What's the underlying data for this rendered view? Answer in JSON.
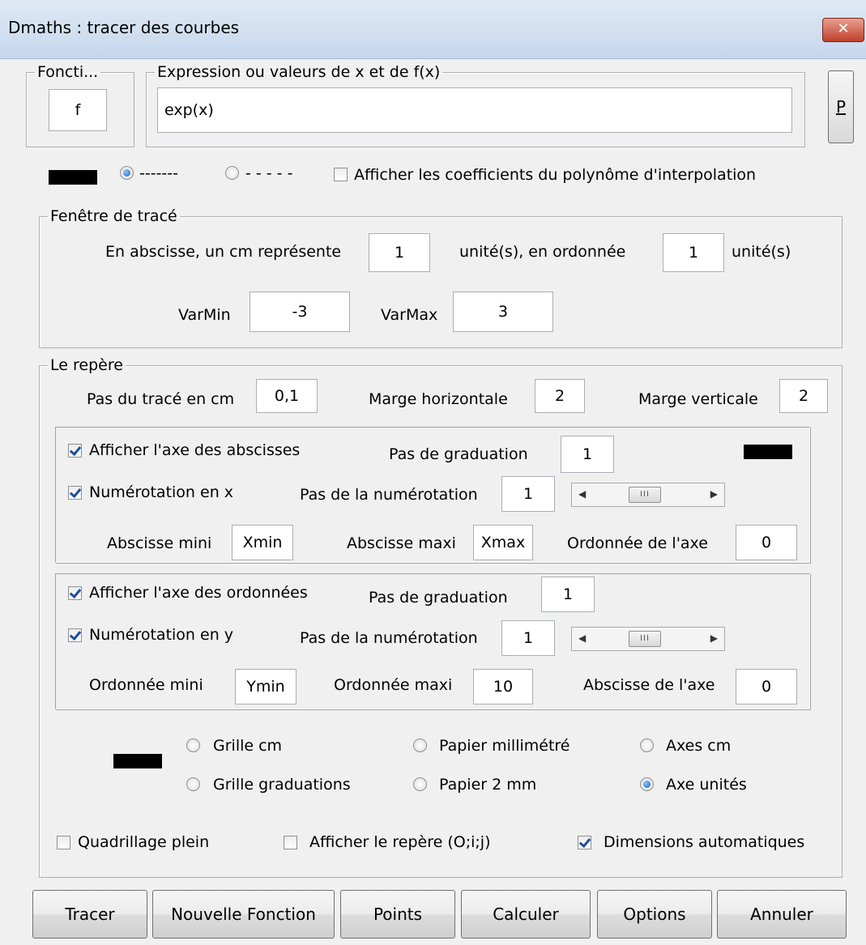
{
  "window": {
    "title": "Dmaths : tracer des courbes",
    "close_glyph": "✕"
  },
  "fonction": {
    "legend": "Foncti...",
    "value": "f"
  },
  "expression": {
    "legend": "Expression ou valeurs de x et de f(x)",
    "value": "exp(x)"
  },
  "p_button": "P",
  "line_style": {
    "color": "#000000",
    "solid_label": "-------",
    "dashed_label": "- - - - -",
    "solid_selected": true,
    "show_coeffs_label": "Afficher les coefficients du polynôme d'interpolation",
    "show_coeffs_checked": false
  },
  "fenetre": {
    "legend": "Fenêtre de tracé",
    "abscisse_label": "En abscisse, un cm représente",
    "abscisse_value": "1",
    "ordonnee_label": "unité(s), en ordonnée",
    "ordonnee_value": "1",
    "unit_label": "unité(s)",
    "varmin_label": "VarMin",
    "varmin_value": "-3",
    "varmax_label": "VarMax",
    "varmax_value": "3"
  },
  "repere": {
    "legend": "Le repère",
    "pas_trace_label": "Pas du tracé en cm",
    "pas_trace_value": "0,1",
    "marge_h_label": "Marge horizontale",
    "marge_h_value": "2",
    "marge_v_label": "Marge verticale",
    "marge_v_value": "2"
  },
  "axe_x": {
    "show_label": "Afficher l'axe des abscisses",
    "show_checked": true,
    "grad_label": "Pas de graduation",
    "grad_value": "1",
    "num_label": "Numérotation en x",
    "num_checked": true,
    "num_pas_label": "Pas de la numérotation",
    "num_pas_value": "1",
    "min_label": "Abscisse mini",
    "min_value": "Xmin",
    "max_label": "Abscisse maxi",
    "max_value": "Xmax",
    "axis_label": "Ordonnée de l'axe",
    "axis_value": "0",
    "color": "#000000"
  },
  "axe_y": {
    "show_label": "Afficher l'axe des ordonnées",
    "show_checked": true,
    "grad_label": "Pas de graduation",
    "grad_value": "1",
    "num_label": "Numérotation en y",
    "num_checked": true,
    "num_pas_label": "Pas de la numérotation",
    "num_pas_value": "1",
    "min_label": "Ordonnée mini",
    "min_value": "Ymin",
    "max_label": "Ordonnée maxi",
    "max_value": "10",
    "axis_label": "Abscisse de l'axe",
    "axis_value": "0"
  },
  "grille": {
    "color": "#000000",
    "grille_cm": "Grille cm",
    "papier_mm": "Papier millimétré",
    "axes_cm": "Axes cm",
    "grille_grad": "Grille graduations",
    "papier_2mm": "Papier 2 mm",
    "axe_unites": "Axe unités",
    "selected": "axe_unites"
  },
  "options": {
    "quadrillage": "Quadrillage plein",
    "quadrillage_checked": false,
    "afficher_repere": "Afficher le repère (O;i;j)",
    "afficher_repere_checked": false,
    "dimensions_auto": "Dimensions automatiques",
    "dimensions_auto_checked": true
  },
  "buttons": {
    "tracer": "Tracer",
    "nouvelle": "Nouvelle Fonction",
    "points": "Points",
    "calculer": "Calculer",
    "options": "Options",
    "annuler": "Annuler"
  },
  "scroll_thumb_glyph": "III"
}
